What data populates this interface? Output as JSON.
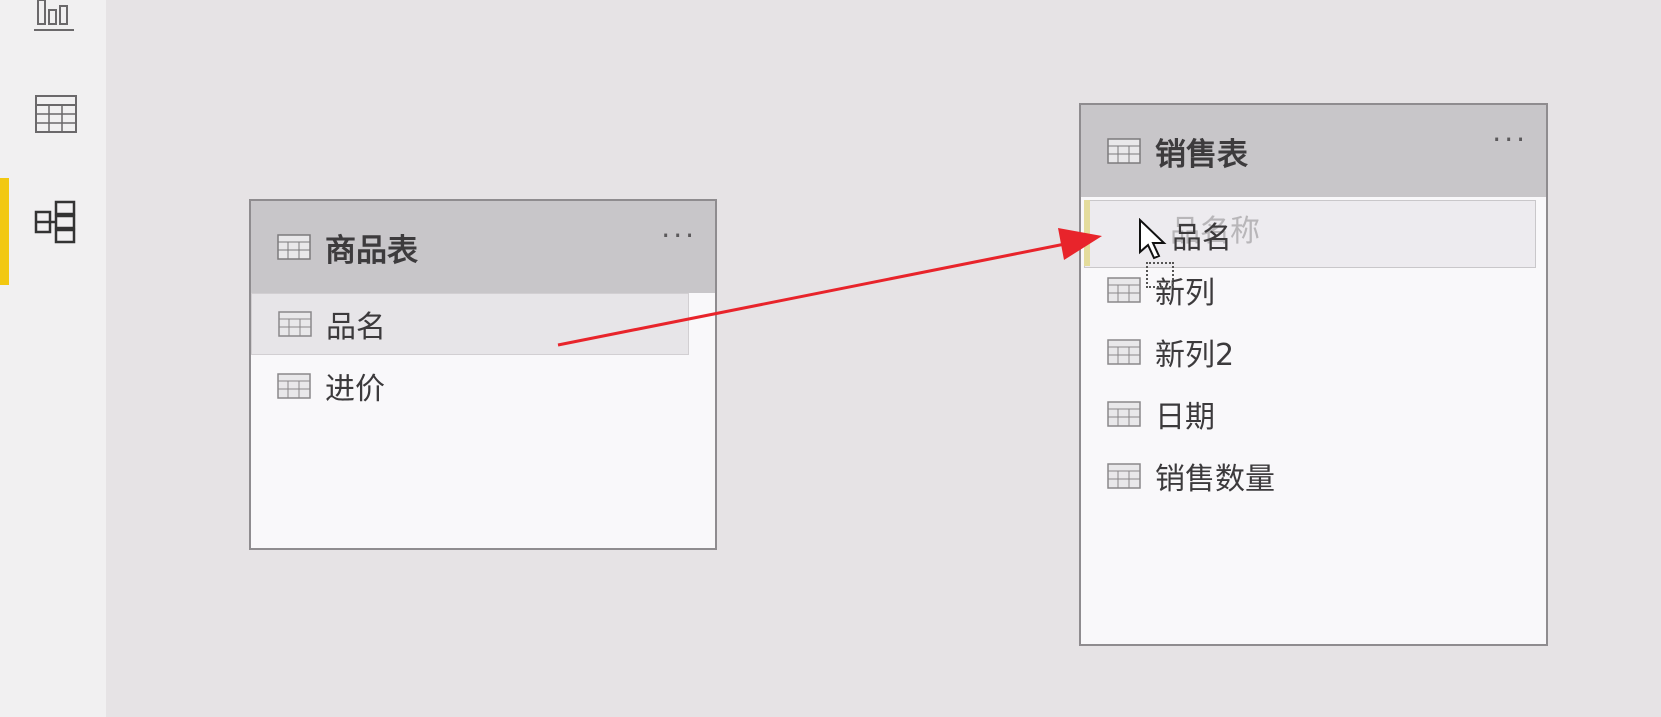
{
  "left_rail": {
    "items": [
      {
        "icon": "report-chart-icon",
        "active": false
      },
      {
        "icon": "data-table-icon",
        "active": false
      },
      {
        "icon": "model-relationship-icon",
        "active": true
      }
    ],
    "accent_color": "#f2c811"
  },
  "tables": [
    {
      "title": "商品表",
      "more_label": "···",
      "fields": [
        "品名",
        "进价"
      ],
      "selected_field": "品名"
    },
    {
      "title": "销售表",
      "more_label": "···",
      "fields": [
        "品名",
        "新列",
        "新列2",
        "日期",
        "销售数量"
      ],
      "ghost_field": "品名称"
    }
  ],
  "drag": {
    "source_field": "品名",
    "target_field": "品名",
    "arrow_color": "#e8242b"
  }
}
